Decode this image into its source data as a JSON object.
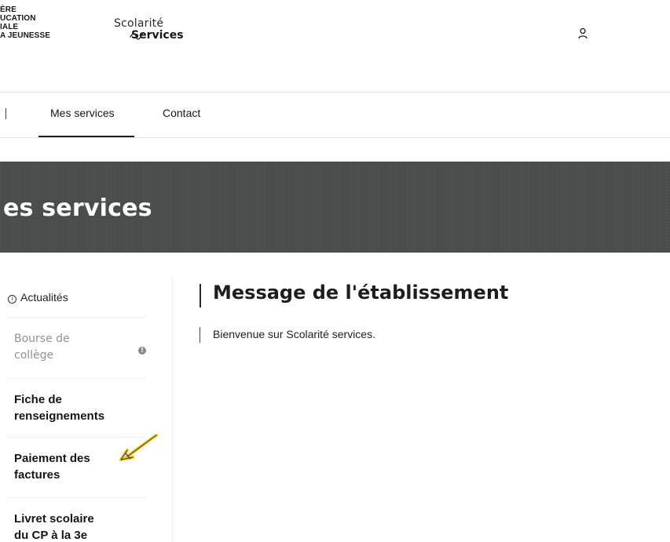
{
  "header": {
    "ministry_lines": [
      "ÈRE",
      "UCATION",
      "IALE",
      "A JEUNESSE"
    ],
    "logo_line1": "Scolarité",
    "logo_line2": "Services",
    "user_icon": "user-icon"
  },
  "nav": {
    "tabs": [
      {
        "label": "Mes services",
        "active": true
      },
      {
        "label": "Contact",
        "active": false
      }
    ]
  },
  "banner": {
    "title": "es services",
    "background_color": "#4b4d4d"
  },
  "sidebar": {
    "actualites_icon": "info-circle-icon",
    "actualites_label": "Actualités",
    "items": [
      {
        "label_line1": "Bourse de",
        "label_line2": "collège",
        "state": "disabled",
        "icon": "info-icon"
      },
      {
        "label_line1": "Fiche de",
        "label_line2": "renseignements",
        "state": "enabled"
      },
      {
        "label_line1": "Paiement des",
        "label_line2": "factures",
        "state": "enabled"
      },
      {
        "label_line1": "Livret scolaire",
        "label_line2": "du CP à la 3e",
        "state": "enabled"
      }
    ],
    "annotation": "handwritten-arrow",
    "annotation_color": "#f2c51f"
  },
  "main": {
    "title": "Message de l'établissement",
    "message": "Bienvenue sur Scolarité services."
  }
}
